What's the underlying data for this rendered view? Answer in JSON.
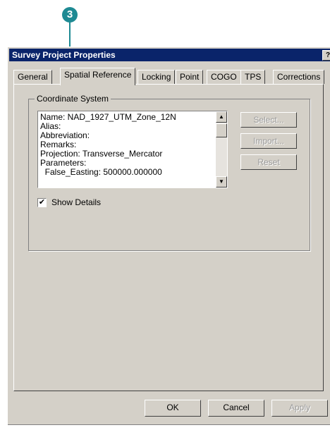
{
  "callout": {
    "number": "3"
  },
  "window": {
    "title": "Survey Project Properties",
    "help_glyph": "?",
    "close_glyph": "X"
  },
  "tabs": [
    {
      "label": "General"
    },
    {
      "label": "Spatial Reference"
    },
    {
      "label": "Locking"
    },
    {
      "label": "Point"
    },
    {
      "label": "COGO"
    },
    {
      "label": "TPS"
    },
    {
      "label": "Corrections"
    }
  ],
  "coordinate_system": {
    "group_label": "Coordinate System",
    "lines": [
      "Name: NAD_1927_UTM_Zone_12N",
      "Alias:",
      "Abbreviation:",
      "Remarks:",
      "Projection: Transverse_Mercator",
      "Parameters:",
      "  False_Easting: 500000.000000"
    ],
    "buttons": {
      "select": "Select...",
      "import": "Import...",
      "reset": "Reset"
    },
    "show_details": {
      "label": "Show Details",
      "checked": true
    }
  },
  "footer": {
    "ok": "OK",
    "cancel": "Cancel",
    "apply": "Apply"
  }
}
